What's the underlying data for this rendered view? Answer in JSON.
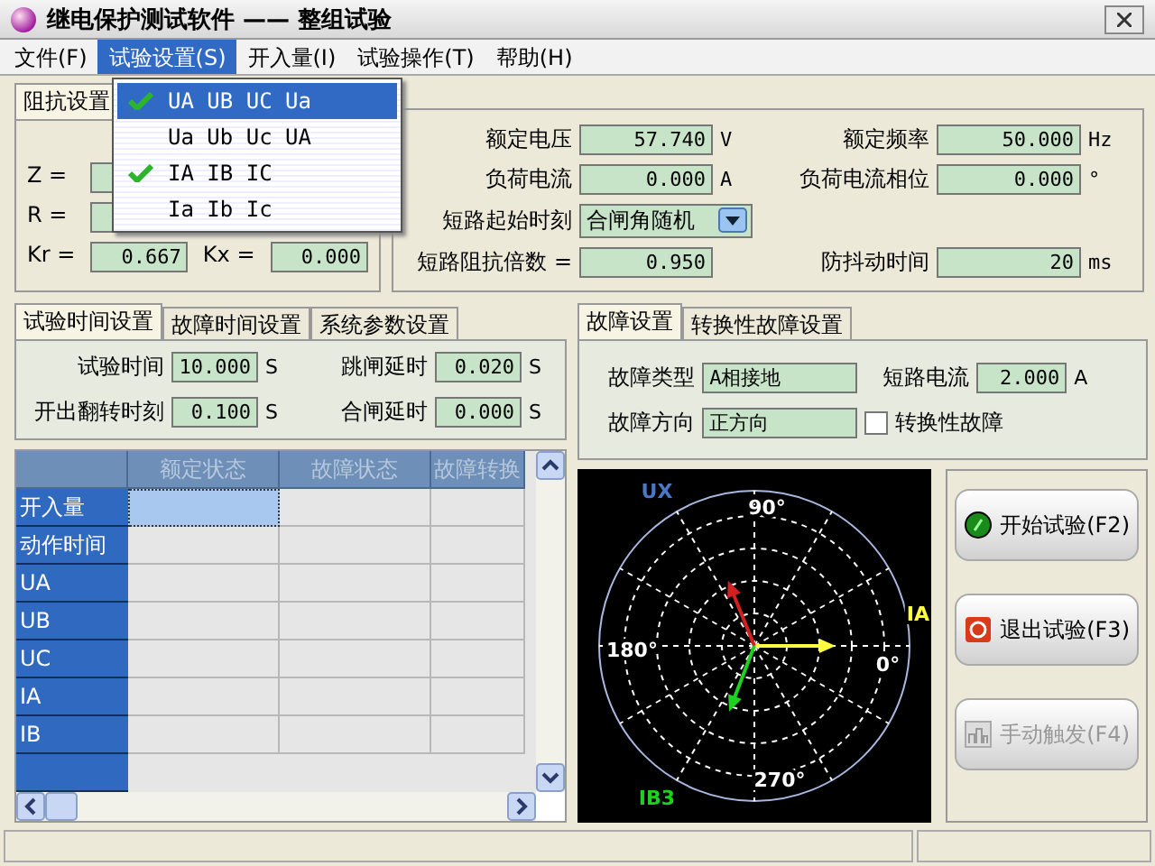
{
  "window": {
    "title": "继电保护测试软件 —— 整组试验"
  },
  "menu": [
    {
      "label": "文件(F)",
      "selected": false
    },
    {
      "label": "试验设置(S)",
      "selected": true
    },
    {
      "label": "开入量(I)",
      "selected": false
    },
    {
      "label": "试验操作(T)",
      "selected": false
    },
    {
      "label": "帮助(H)",
      "selected": false
    }
  ],
  "dropdown": [
    {
      "label": "UA UB UC Ua",
      "checked": true,
      "selected": true
    },
    {
      "label": "Ua Ub Uc UA",
      "checked": false,
      "selected": false
    },
    {
      "label": "IA IB IC",
      "checked": true,
      "selected": false
    },
    {
      "label": "Ia Ib Ic",
      "checked": false,
      "selected": false
    }
  ],
  "impedance": {
    "tab": "阻抗设置",
    "fields": [
      {
        "label": "Z ="
      },
      {
        "label": "R ="
      },
      {
        "label": "Kr =",
        "value": "0.667"
      },
      {
        "label": "Kx =",
        "value": "0.000"
      }
    ]
  },
  "rated": {
    "rows": [
      {
        "left": {
          "kind": "field",
          "label": "额定电压",
          "value": "57.740",
          "unit": "V"
        },
        "right": {
          "kind": "field",
          "label": "额定频率",
          "value": "50.000",
          "unit": "Hz"
        }
      },
      {
        "left": {
          "kind": "field",
          "label": "负荷电流",
          "value": "0.000",
          "unit": "A"
        },
        "right": {
          "kind": "field",
          "label": "负荷电流相位",
          "value": "0.000",
          "unit": "°"
        }
      },
      {
        "left": {
          "kind": "select",
          "label": "短路起始时刻",
          "value": "合闸角随机"
        }
      },
      {
        "left": {
          "kind": "field",
          "label": "短路阻抗倍数 =",
          "value": "0.950"
        },
        "right": {
          "kind": "field",
          "label": "防抖动时间",
          "value": "20",
          "unit": "ms"
        }
      }
    ]
  },
  "time_tabs": [
    {
      "label": "试验时间设置",
      "selected": true
    },
    {
      "label": "故障时间设置",
      "selected": false
    },
    {
      "label": "系统参数设置",
      "selected": false
    }
  ],
  "time_fields": [
    {
      "label": "试验时间",
      "value": "10.000",
      "unit": "S"
    },
    {
      "label": "跳闸延时",
      "value": "0.020",
      "unit": "S"
    },
    {
      "label": "开出翻转时刻",
      "value": "0.100",
      "unit": "S"
    },
    {
      "label": "合闸延时",
      "value": "0.000",
      "unit": "S"
    }
  ],
  "table": {
    "columns": [
      "额定状态",
      "故障状态",
      "故障转换"
    ],
    "rows": [
      {
        "label": "开入量",
        "selected": true
      },
      {
        "label": "动作时间",
        "selected": false
      },
      {
        "label": "UA",
        "selected": false
      },
      {
        "label": "UB",
        "selected": false
      },
      {
        "label": "UC",
        "selected": false
      },
      {
        "label": "IA",
        "selected": false
      },
      {
        "label": "IB",
        "selected": false
      }
    ]
  },
  "fault_tabs": [
    {
      "label": "故障设置",
      "selected": true
    },
    {
      "label": "转换性故障设置",
      "selected": false
    }
  ],
  "fault_fields": [
    {
      "kind": "select",
      "label": "故障类型",
      "value": "A相接地"
    },
    {
      "kind": "field",
      "label": "短路电流",
      "value": "2.000",
      "unit": "A"
    },
    {
      "kind": "select",
      "label": "故障方向",
      "value": "正方向"
    },
    {
      "kind": "check",
      "label": "转换性故障",
      "checked": false
    }
  ],
  "phasor": {
    "top_label": "UX",
    "angle_90": "90°",
    "angle_180": "180°",
    "angle_0": "0°",
    "angle_270": "270°",
    "right_label": "IA",
    "bottom_label": "IB3"
  },
  "buttons": [
    {
      "kind": "start",
      "label": "开始试验(F2)",
      "disabled": false
    },
    {
      "kind": "stop",
      "label": "退出试验(F3)",
      "disabled": false
    },
    {
      "kind": "manual",
      "label": "手动触发(F4)",
      "disabled": true
    }
  ]
}
